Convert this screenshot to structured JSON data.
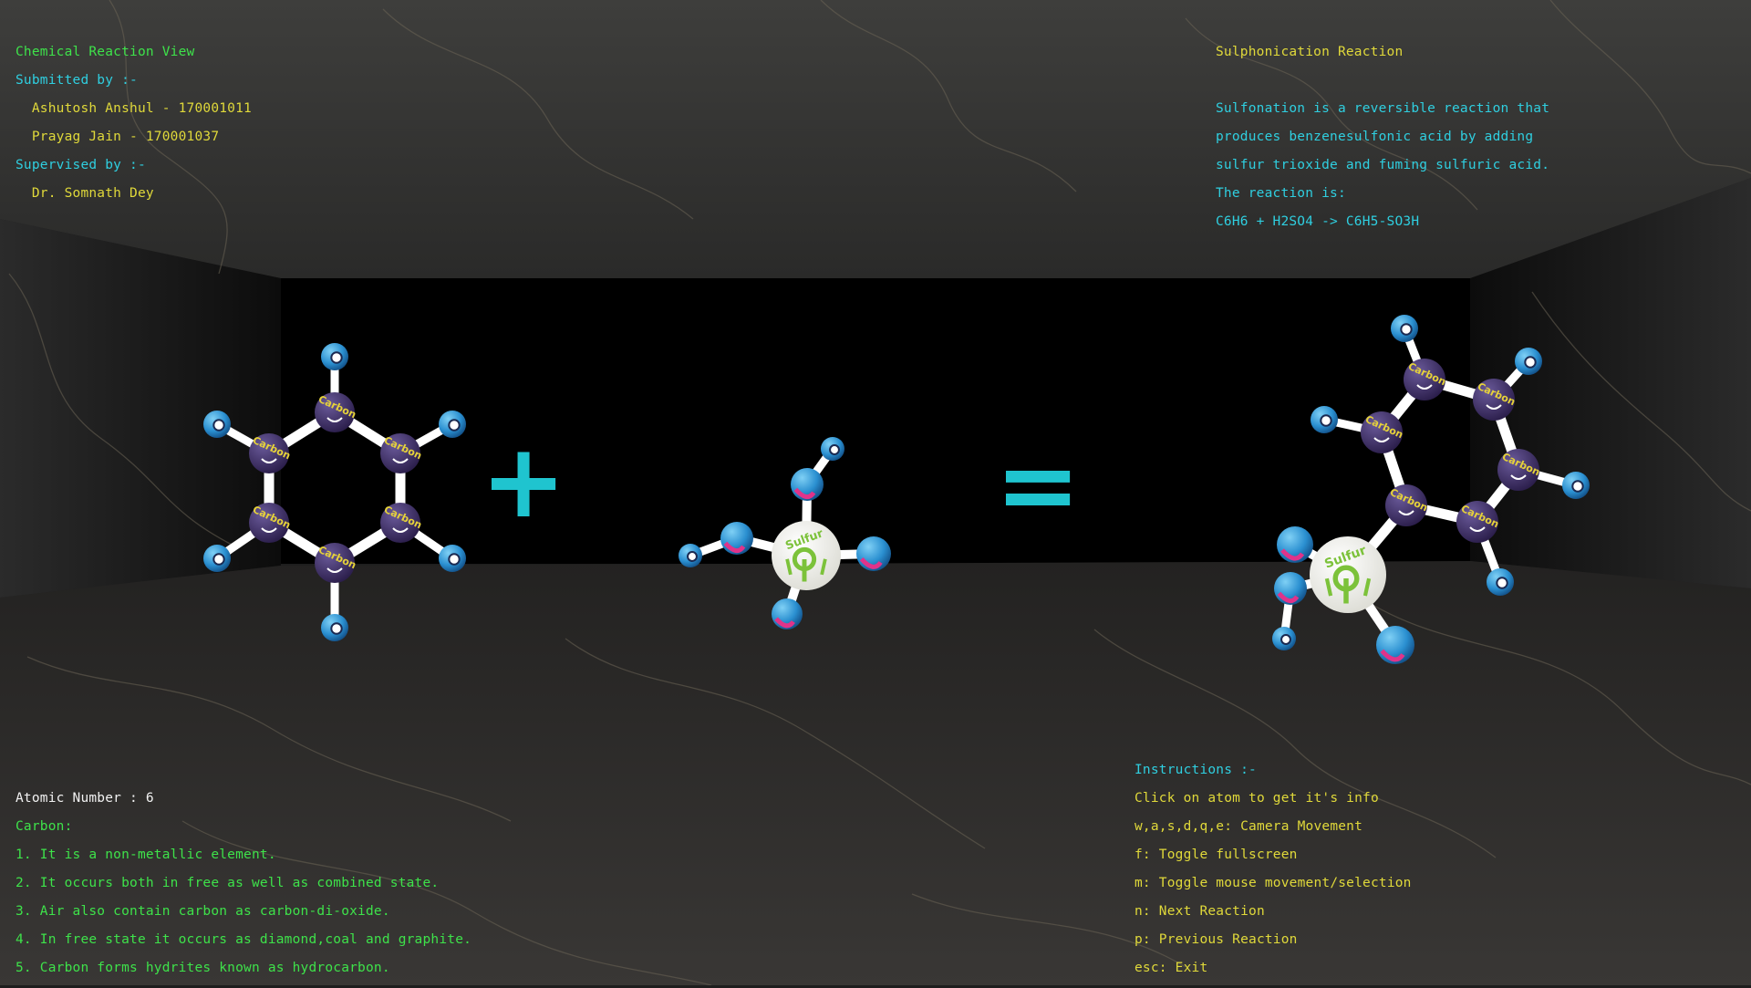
{
  "colors": {
    "title_green": "#3ee24a",
    "yellow_text": "#e0d93a",
    "cyan_text": "#2fcfe0",
    "white_text": "#f2f2f2",
    "symbol_cyan": "#1fc4cf",
    "carbon_atom": "#3a2a5e",
    "hydrogen_atom": "#2a8fd0",
    "sulfur_atom": "#f4f4f0",
    "oxygen_atom": "#2a7ad0",
    "bond": "#ffffff"
  },
  "header_left": {
    "title": "Chemical Reaction View",
    "submitted_label": "Submitted by :-",
    "authors": [
      "  Ashutosh Anshul - 170001011",
      "  Prayag Jain - 170001037"
    ],
    "supervised_label": "Supervised by :-",
    "supervisor": "  Dr. Somnath Dey"
  },
  "header_right": {
    "title": "Sulphonication Reaction",
    "description": [
      "Sulfonation is a reversible reaction that",
      "produces benzenesulfonic acid by adding",
      "sulfur trioxide and fuming sulfuric acid.",
      "The reaction is:"
    ],
    "equation": "C6H6 + H2SO4 -> C6H5-SO3H"
  },
  "scene": {
    "plus_symbol": "+",
    "equals_symbol": "=",
    "atom_labels": {
      "carbon": "Carbon",
      "sulfur": "Sulfur"
    },
    "molecules": [
      "benzene-molecule",
      "sulfuric-acid-molecule",
      "benzenesulfonic-acid-molecule"
    ]
  },
  "atom_info": {
    "atomic_number": "Atomic Number : 6",
    "element": "Carbon:",
    "facts": [
      "1. It is a non-metallic element.",
      "2. It occurs both in free as well as combined state.",
      "3. Air also contain carbon as carbon-di-oxide.",
      "4. In free state it occurs as diamond,coal and graphite.",
      "5. Carbon forms hydrites known as hydrocarbon."
    ]
  },
  "instructions": {
    "title": "Instructions :-",
    "items": [
      "Click on atom to get it's info",
      "w,a,s,d,q,e: Camera Movement",
      "f: Toggle fullscreen",
      "m: Toggle mouse movement/selection",
      "n: Next Reaction",
      "p: Previous Reaction",
      "esc: Exit"
    ]
  }
}
